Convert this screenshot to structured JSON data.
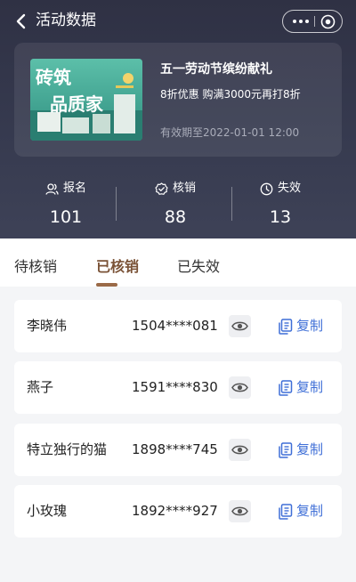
{
  "nav": {
    "title": "活动数据"
  },
  "activity": {
    "title": "五一劳动节缤纷献礼",
    "description": "8折优惠 购满3000元再打8折",
    "validity": "有效期至2022-01-01 12:00",
    "thumbnail": {
      "lines": [
        "砖筑",
        "品质家"
      ]
    }
  },
  "stats": [
    {
      "label": "报名",
      "value": "101",
      "icon": "user-group-icon"
    },
    {
      "label": "核销",
      "value": "88",
      "icon": "verified-badge-icon"
    },
    {
      "label": "失效",
      "value": "13",
      "icon": "clock-icon"
    }
  ],
  "tabs": [
    {
      "label": "待核销",
      "active": false
    },
    {
      "label": "已核销",
      "active": true
    },
    {
      "label": "已失效",
      "active": false
    }
  ],
  "records": [
    {
      "name": "李晓伟",
      "phone": "1504****081",
      "copy_label": "复制"
    },
    {
      "name": "燕子",
      "phone": "1591****830",
      "copy_label": "复制"
    },
    {
      "name": "特立独行的猫",
      "phone": "1898****745",
      "copy_label": "复制"
    },
    {
      "name": "小玫瑰",
      "phone": "1892****927",
      "copy_label": "复制"
    }
  ],
  "colors": {
    "header_bg": "#33364a",
    "tab_active": "#7a5236",
    "tab_indicator": "#9a6a47",
    "copy_link": "#3f6fd7",
    "page_bg": "#f4f5f7"
  }
}
